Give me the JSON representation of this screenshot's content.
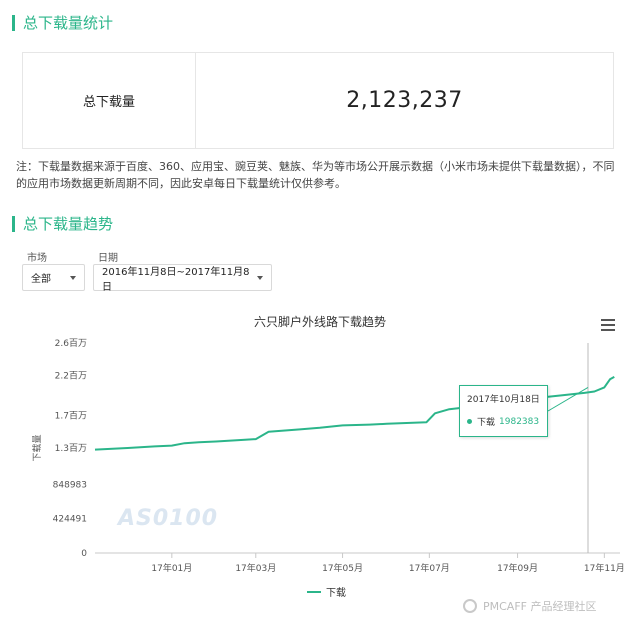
{
  "sections": {
    "total_downloads_title": "总下载量统计",
    "trend_title": "总下载量趋势"
  },
  "stat": {
    "label": "总下载量",
    "value": "2,123,237"
  },
  "note": "注：下载量数据来源于百度、360、应用宝、豌豆荚、魅族、华为等市场公开展示数据（小米市场未提供下载量数据），不同的应用市场数据更新周期不同，因此安卓每日下载量统计仅供参考。",
  "filters": {
    "market_label": "市场",
    "market_value": "全部",
    "date_label": "日期",
    "date_value": "2016年11月8日~2017年11月8日"
  },
  "chart_data": {
    "type": "line",
    "title": "六只脚户外线路下载趋势",
    "ylabel": "下载量",
    "xlabel": "",
    "ylim": [
      0,
      2600000
    ],
    "y_ticks": [
      0,
      424491,
      848983,
      1300000,
      1700000,
      2200000,
      2600000
    ],
    "y_tick_labels": [
      "0",
      "424491",
      "848983",
      "1.3百万",
      "1.7百万",
      "2.2百万",
      "2.6百万"
    ],
    "x_ticks": [
      "2017-01-01",
      "2017-03-01",
      "2017-05-01",
      "2017-07-01",
      "2017-09-01",
      "2017-11-01"
    ],
    "x_tick_labels": [
      "17年01月",
      "17年03月",
      "17年05月",
      "17年07月",
      "17年09月",
      "17年11月"
    ],
    "grid": false,
    "legend": "bottom",
    "series": [
      {
        "name": "下载",
        "color": "#2bb58a",
        "x": [
          "2016-11-08",
          "2016-12-01",
          "2016-12-20",
          "2017-01-01",
          "2017-01-10",
          "2017-01-20",
          "2017-02-01",
          "2017-02-20",
          "2017-03-01",
          "2017-03-10",
          "2017-04-01",
          "2017-04-15",
          "2017-05-01",
          "2017-05-20",
          "2017-06-01",
          "2017-06-15",
          "2017-06-29",
          "2017-07-05",
          "2017-07-15",
          "2017-07-25",
          "2017-08-01",
          "2017-08-15",
          "2017-09-01",
          "2017-09-15",
          "2017-10-01",
          "2017-10-18",
          "2017-10-25",
          "2017-11-01",
          "2017-11-05",
          "2017-11-08"
        ],
        "values": [
          1280000,
          1300000,
          1320000,
          1330000,
          1360000,
          1370000,
          1380000,
          1400000,
          1410000,
          1500000,
          1530000,
          1550000,
          1580000,
          1590000,
          1600000,
          1610000,
          1620000,
          1730000,
          1780000,
          1800000,
          1820000,
          1860000,
          1890000,
          1920000,
          1950000,
          1982383,
          2000000,
          2050000,
          2150000,
          2180000
        ]
      }
    ],
    "tooltip": {
      "date": "2017年10月18日",
      "series": "下载",
      "value": "1982383"
    }
  },
  "watermark": "AS0100",
  "brand": "PMCAFF 产品经理社区"
}
